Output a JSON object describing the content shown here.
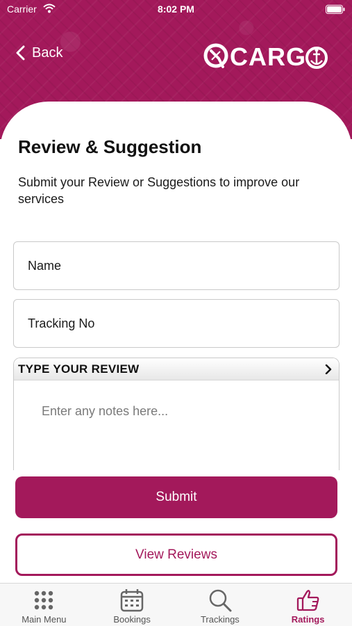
{
  "status_bar": {
    "carrier": "Carrier",
    "time": "8:02 PM"
  },
  "header": {
    "back_label": "Back",
    "logo_text": "CARG"
  },
  "page": {
    "title": "Review & Suggestion",
    "subtitle": "Submit your Review or Suggestions to improve our services"
  },
  "form": {
    "name_placeholder": "Name",
    "tracking_placeholder": "Tracking No",
    "review_header": "TYPE YOUR REVIEW",
    "review_placeholder": "Enter any notes here..."
  },
  "actions": {
    "submit_label": "Submit",
    "view_reviews_label": "View Reviews"
  },
  "tabbar": {
    "items": [
      {
        "label": "Main Menu",
        "icon": "grid-icon"
      },
      {
        "label": "Bookings",
        "icon": "calendar-icon"
      },
      {
        "label": "Trackings",
        "icon": "search-icon"
      },
      {
        "label": "Ratings",
        "icon": "thumbs-up-icon"
      }
    ],
    "active": "Ratings"
  },
  "colors": {
    "brand": "#a3195b",
    "inactive": "#555555",
    "border": "#c9c9c9"
  }
}
